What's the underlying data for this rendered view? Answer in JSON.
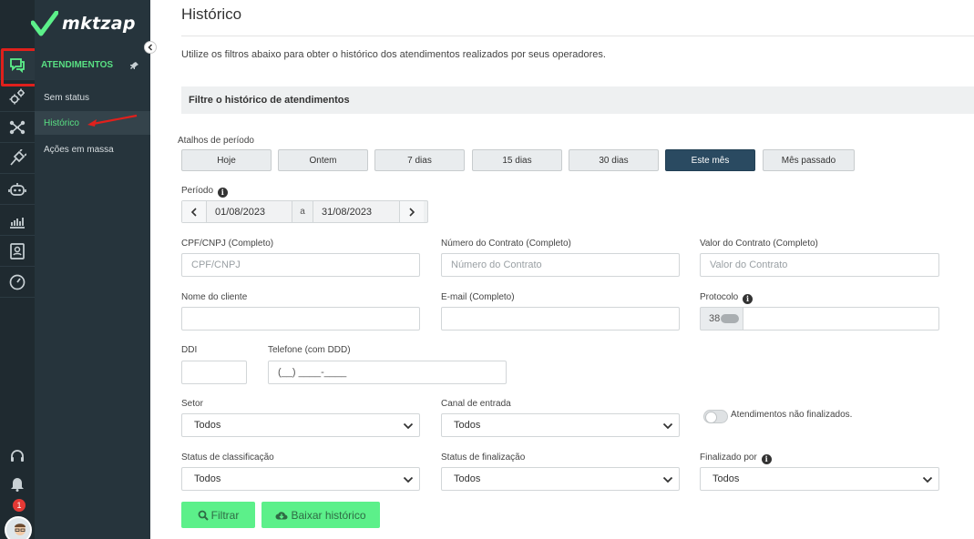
{
  "brand": {
    "logo_text": "mktzap"
  },
  "sidebar": {
    "section_title": "ATENDIMENTOS",
    "items": [
      {
        "label": "Sem status"
      },
      {
        "label": "Histórico"
      },
      {
        "label": "Ações em massa"
      }
    ],
    "notification_count": "1"
  },
  "page": {
    "title": "Histórico",
    "description": "Utilize os filtros abaixo para obter o histórico dos atendimentos realizados por seus operadores.",
    "filter_header": "Filtre o histórico de atendimentos"
  },
  "shortcuts": {
    "label": "Atalhos de período",
    "items": [
      {
        "label": "Hoje"
      },
      {
        "label": "Ontem"
      },
      {
        "label": "7 dias"
      },
      {
        "label": "15 dias"
      },
      {
        "label": "30 dias"
      },
      {
        "label": "Este mês"
      },
      {
        "label": "Mês passado"
      }
    ],
    "active": "Este mês"
  },
  "period": {
    "label": "Período",
    "start": "01/08/2023",
    "separator": "a",
    "end": "31/08/2023"
  },
  "fields": {
    "cpf": {
      "label": "CPF/CNPJ (Completo)",
      "placeholder": "CPF/CNPJ"
    },
    "contract_number": {
      "label": "Número do Contrato (Completo)",
      "placeholder": "Número do Contrato"
    },
    "contract_value": {
      "label": "Valor do Contrato (Completo)",
      "placeholder": "Valor do Contrato"
    },
    "client_name": {
      "label": "Nome do cliente",
      "placeholder": ""
    },
    "email": {
      "label": "E-mail (Completo)",
      "placeholder": ""
    },
    "protocol": {
      "label": "Protocolo",
      "prefix": "38",
      "value": ""
    },
    "ddi": {
      "label": "DDI",
      "value": ""
    },
    "phone": {
      "label": "Telefone (com DDD)",
      "placeholder": "(__) ____-____"
    },
    "sector": {
      "label": "Setor",
      "selected": "Todos"
    },
    "channel": {
      "label": "Canal de entrada",
      "selected": "Todos"
    },
    "unfinished_toggle": {
      "label": "Atendimentos não finalizados.",
      "on": false
    },
    "classification_status": {
      "label": "Status de classificação",
      "selected": "Todos"
    },
    "finalization_status": {
      "label": "Status de finalização",
      "selected": "Todos"
    },
    "finalized_by": {
      "label": "Finalizado por",
      "selected": "Todos"
    }
  },
  "actions": {
    "filter": "Filtrar",
    "download": "Baixar histórico"
  },
  "colors": {
    "rail_bg": "#1f2a30",
    "panel_bg": "#26343c",
    "accent_green": "#59e083",
    "button_green": "#5cf08a",
    "active_shortcut": "#2a4a61",
    "highlight_red": "#e0201c"
  }
}
